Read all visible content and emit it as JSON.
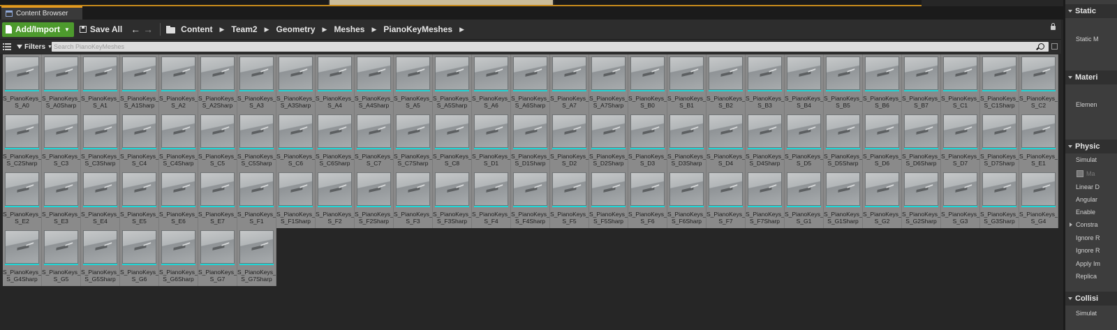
{
  "tab": {
    "title": "Content Browser"
  },
  "toolbar": {
    "add_import_label": "Add/Import",
    "save_all_label": "Save All",
    "breadcrumbs": [
      "Content",
      "Team2",
      "Geometry",
      "Meshes",
      "PianoKeyMeshes"
    ]
  },
  "filterbar": {
    "filters_label": "Filters",
    "search_placeholder": "Search PianoKeyMeshes"
  },
  "assets": [
    "S_A0",
    "S_A0Sharp",
    "S_A1",
    "S_A1Sharp",
    "S_A2",
    "S_A2Sharp",
    "S_A3",
    "S_A3Sharp",
    "S_A4",
    "S_A4Sharp",
    "S_A5",
    "S_A5Sharp",
    "S_A6",
    "S_A6Sharp",
    "S_A7",
    "S_A7Sharp",
    "S_B0",
    "S_B1",
    "S_B2",
    "S_B3",
    "S_B4",
    "S_B5",
    "S_B6",
    "S_B7",
    "S_C1",
    "S_C1Sharp",
    "S_C2",
    "S_C2Sharp",
    "S_C3",
    "S_C3Sharp",
    "S_C4",
    "S_C4Sharp",
    "S_C5",
    "S_C5Sharp",
    "S_C6",
    "S_C6Sharp",
    "S_C7",
    "S_C7Sharp",
    "S_C8",
    "S_D1",
    "S_D1Sharp",
    "S_D2",
    "S_D2Sharp",
    "S_D3",
    "S_D3Sharp",
    "S_D4",
    "S_D4Sharp",
    "S_D5",
    "S_D5Sharp",
    "S_D6",
    "S_D6Sharp",
    "S_D7",
    "S_D7Sharp",
    "S_E1",
    "S_E2",
    "S_E3",
    "S_E4",
    "S_E5",
    "S_E6",
    "S_E7",
    "S_F1",
    "S_F1Sharp",
    "S_F2",
    "S_F2Sharp",
    "S_F3",
    "S_F3Sharp",
    "S_F4",
    "S_F4Sharp",
    "S_F5",
    "S_F5Sharp",
    "S_F6",
    "S_F6Sharp",
    "S_F7",
    "S_F7Sharp",
    "S_G1",
    "S_G1Sharp",
    "S_G2",
    "S_G2Sharp",
    "S_G3",
    "S_G3Sharp",
    "S_G4",
    "S_G4Sharp",
    "S_G5",
    "S_G5Sharp",
    "S_G6",
    "S_G6Sharp",
    "S_G7",
    "S_G7Sharp"
  ],
  "asset_prefix": "S_PianoKeys_",
  "details": {
    "headers": [
      "Static",
      "Materi",
      "Physic",
      "Collisi"
    ],
    "rows": [
      "Static M",
      "Elemen",
      "Simulat",
      "Ma",
      "Linear D",
      "Angular",
      "Enable",
      "Constra",
      "Ignore R",
      "Ignore R",
      "Apply Im",
      "Replica",
      "Simulat"
    ]
  },
  "colors": {
    "accent_green": "#4d9a2d",
    "tab_accent": "#f0a020",
    "asset_bar": "#20d6d6",
    "tile_bg": "#8a8a8a"
  }
}
